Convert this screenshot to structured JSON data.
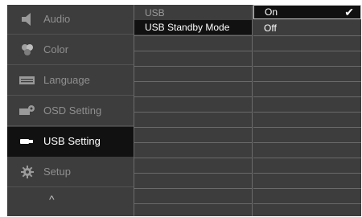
{
  "menu": {
    "items": [
      {
        "label": "Audio",
        "icon": "speaker-icon"
      },
      {
        "label": "Color",
        "icon": "color-circles-icon"
      },
      {
        "label": "Language",
        "icon": "language-txt-icon"
      },
      {
        "label": "OSD Setting",
        "icon": "osd-setting-icon"
      },
      {
        "label": "USB Setting",
        "icon": "usb-icon",
        "active": true
      },
      {
        "label": "Setup",
        "icon": "gear-icon"
      }
    ],
    "scroll_up_label": "^"
  },
  "submenu": {
    "title": "USB",
    "items": [
      {
        "label": "USB Standby Mode",
        "active": true
      }
    ]
  },
  "options": {
    "items": [
      {
        "label": "On",
        "selected": true,
        "checkmark": "✔"
      },
      {
        "label": "Off",
        "selected": false
      }
    ]
  },
  "colors": {
    "panel": "#3d3d3d",
    "active": "#111111",
    "text_dim": "#8f8f8f",
    "text_active": "#ffffff"
  }
}
